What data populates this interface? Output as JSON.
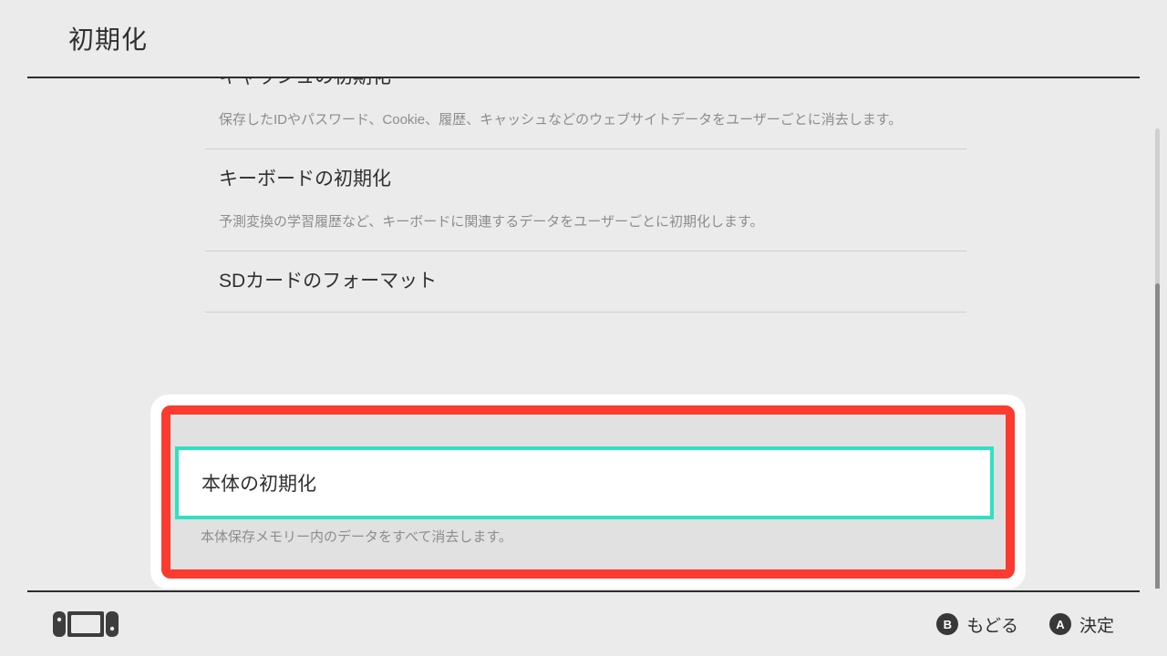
{
  "header": {
    "title": "初期化"
  },
  "items": {
    "cache": {
      "title": "キャッシュの初期化",
      "desc": "保存したIDやパスワード、Cookie、履歴、キャッシュなどのウェブサイトデータをユーザーごとに消去します。"
    },
    "keyboard": {
      "title": "キーボードの初期化",
      "desc": "予測変換の学習履歴など、キーボードに関連するデータをユーザーごとに初期化します。"
    },
    "sdcard": {
      "title": "SDカードのフォーマット"
    },
    "factory": {
      "title": "本体の初期化",
      "desc": "本体保存メモリー内のデータをすべて消去します。"
    }
  },
  "footer": {
    "back": {
      "glyph": "B",
      "label": "もどる"
    },
    "ok": {
      "glyph": "A",
      "label": "決定"
    }
  }
}
